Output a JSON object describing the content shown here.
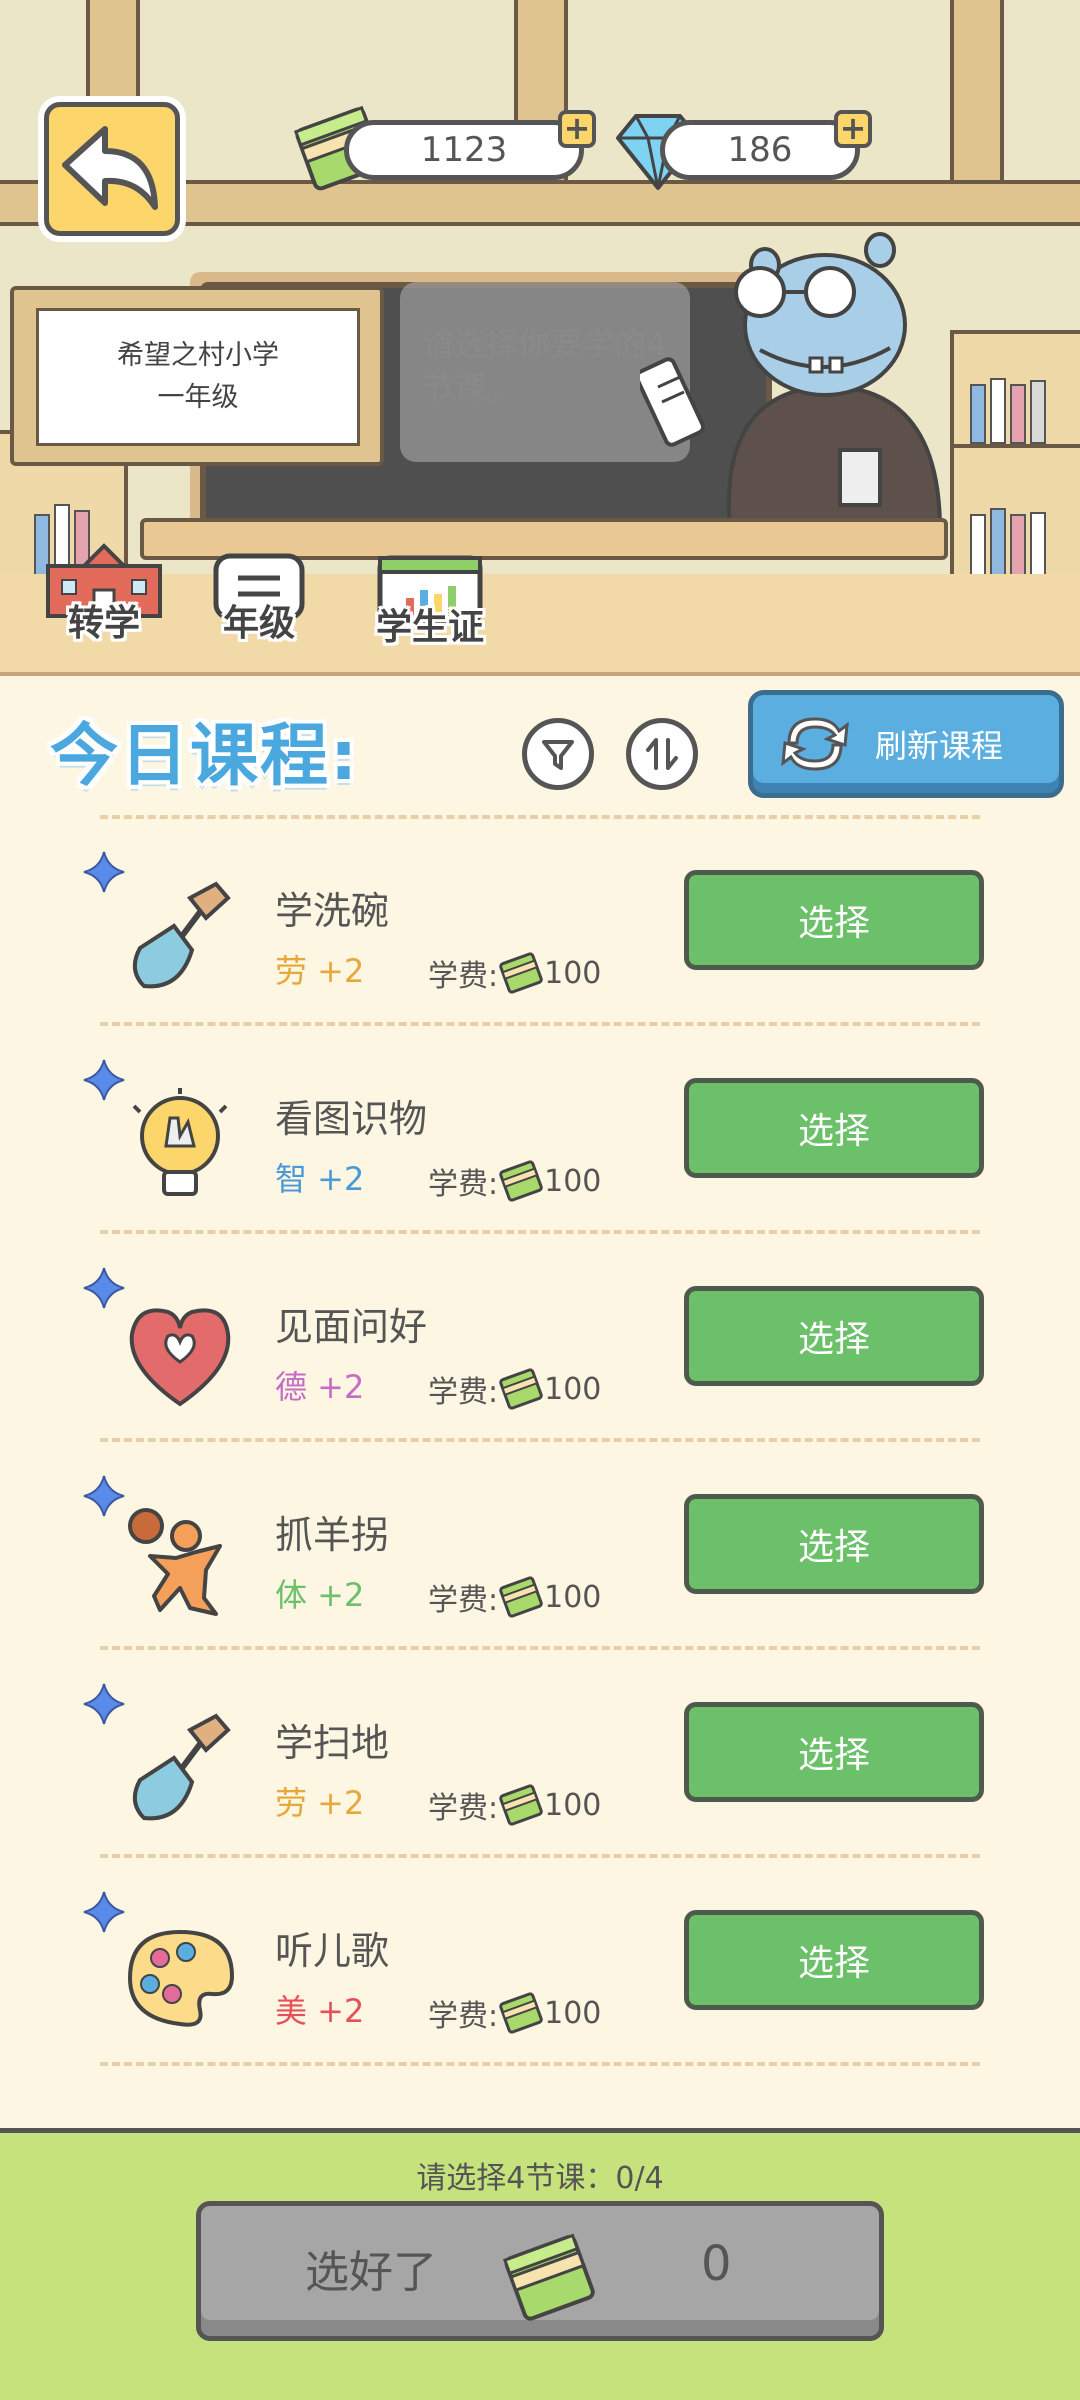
{
  "topbar": {
    "cash_value": "1123",
    "diamond_value": "186"
  },
  "scene": {
    "sign_line1": "希望之村小学",
    "sign_line2": "一年级",
    "speech_text": "请选择你要学的4节课。"
  },
  "nav": {
    "transfer_label": "转学",
    "grade_label": "年级",
    "student_card_label": "学生证"
  },
  "panel": {
    "title": "今日课程:",
    "refresh_label": "刷新课程",
    "fee_label": "学费:"
  },
  "courses": [
    {
      "name": "学洗碗",
      "stat": "劳 +2",
      "stat_color": "#e5a83a",
      "fee": "100",
      "select_label": "选择",
      "icon": "shovel-icon"
    },
    {
      "name": "看图识物",
      "stat": "智 +2",
      "stat_color": "#4a9ad8",
      "fee": "100",
      "select_label": "选择",
      "icon": "lightbulb-icon"
    },
    {
      "name": "见面问好",
      "stat": "德 +2",
      "stat_color": "#c66bc6",
      "fee": "100",
      "select_label": "选择",
      "icon": "heart-icon"
    },
    {
      "name": "抓羊拐",
      "stat": "体 +2",
      "stat_color": "#6cc06a",
      "fee": "100",
      "select_label": "选择",
      "icon": "athlete-icon"
    },
    {
      "name": "学扫地",
      "stat": "劳 +2",
      "stat_color": "#e5a83a",
      "fee": "100",
      "select_label": "选择",
      "icon": "shovel-icon"
    },
    {
      "name": "听儿歌",
      "stat": "美 +2",
      "stat_color": "#e5505a",
      "fee": "100",
      "select_label": "选择",
      "icon": "palette-icon"
    }
  ],
  "footer": {
    "prompt": "请选择4节课：0/4",
    "done_label": "选好了",
    "done_cost": "0"
  }
}
